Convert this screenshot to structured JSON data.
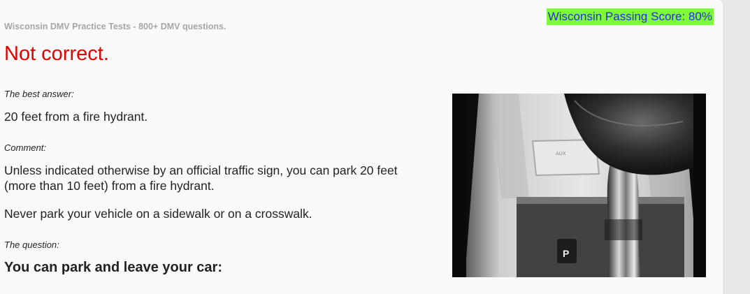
{
  "header": {
    "site_title": "Wisconsin DMV Practice Tests - 800+ DMV questions.",
    "passing_score": "Wisconsin Passing Score: 80%"
  },
  "result": {
    "status": "Not correct."
  },
  "answer": {
    "label": "The best answer:",
    "text": "20 feet from a fire hydrant."
  },
  "comment": {
    "label": "Comment:",
    "paragraph_1": "Unless indicated otherwise by an official traffic sign, you can park 20 feet (more than 10 feet) from a fire hydrant.",
    "paragraph_2": "Never park your vehicle on a sidewalk or on a crosswalk."
  },
  "question": {
    "label": "The question:",
    "text": "You can park and leave your car:"
  },
  "photo": {
    "icon": "gear-shifter-photo",
    "aux_text": "AUX",
    "gear_letter": "P"
  },
  "colors": {
    "badge_bg": "#7cfc3a",
    "badge_text": "#2b2bd6",
    "result_text": "#e30000"
  }
}
